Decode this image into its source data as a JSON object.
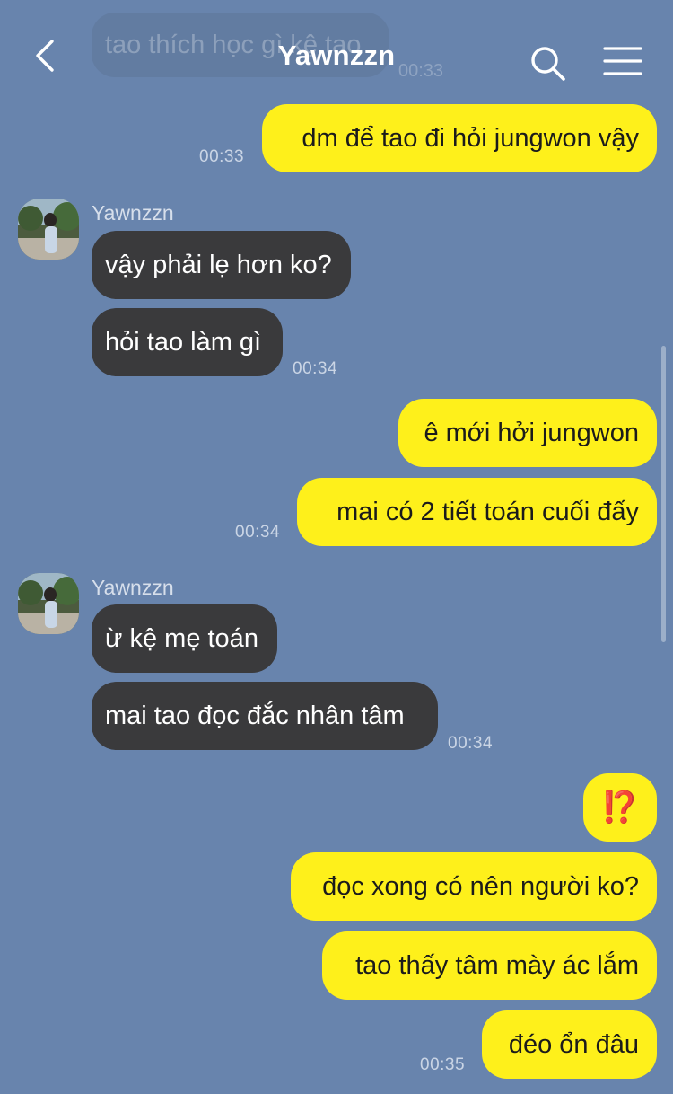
{
  "header": {
    "title": "Yawnzzn"
  },
  "ghost": {
    "text": "tao thích học gì kệ tao",
    "time": "00:33"
  },
  "messages": {
    "m1": {
      "text": "dm để tao đi hỏi jungwon vậy",
      "time": "00:33"
    },
    "g1_sender": "Yawnzzn",
    "m2": {
      "text": "vậy phải lẹ hơn ko?"
    },
    "m3": {
      "text": "hỏi tao làm gì",
      "time": "00:34"
    },
    "m4": {
      "text": "ê mới hởi jungwon"
    },
    "m5": {
      "text": "mai có 2 tiết toán cuối đấy",
      "time": "00:34"
    },
    "g2_sender": "Yawnzzn",
    "m6": {
      "text": "ừ kệ mẹ toán"
    },
    "m7": {
      "text": "mai tao đọc đắc nhân tâm",
      "time": "00:34"
    },
    "m8": {
      "text": "⁉️"
    },
    "m9": {
      "text": "đọc xong có nên người ko?"
    },
    "m10": {
      "text": "tao thấy tâm mày ác lắm"
    },
    "m11": {
      "text": "đéo ổn đâu",
      "time": "00:35"
    }
  },
  "colors": {
    "background": "#6884ad",
    "sent_bubble": "#fef01b",
    "received_bubble": "#3a3a3c"
  },
  "icons": [
    "back-icon",
    "search-icon",
    "menu-icon"
  ]
}
